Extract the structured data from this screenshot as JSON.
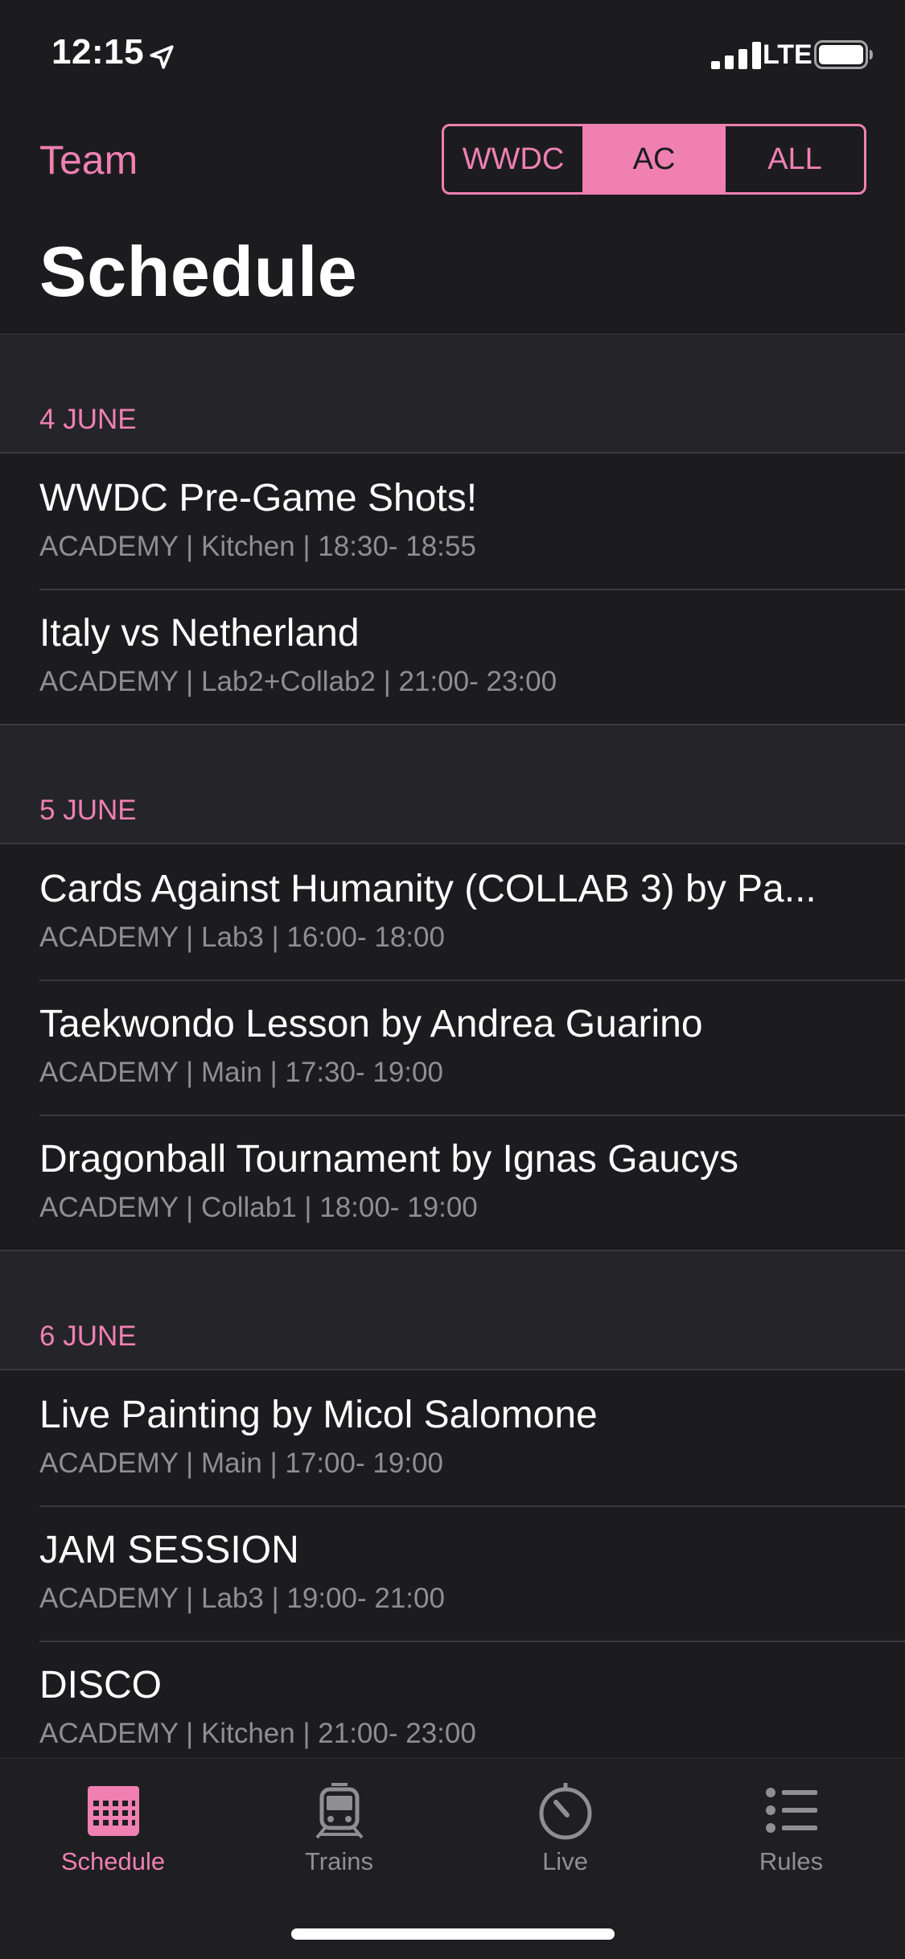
{
  "status_bar": {
    "time": "12:15",
    "network": "LTE"
  },
  "header": {
    "back_label": "Team",
    "title": "Schedule",
    "segments": [
      "WWDC",
      "AC",
      "ALL"
    ],
    "selected_segment": "AC"
  },
  "sections": [
    {
      "title": "4 JUNE",
      "items": [
        {
          "title": "WWDC Pre-Game Shots!",
          "subtitle": "ACADEMY | Kitchen | 18:30- 18:55"
        },
        {
          "title": "Italy vs Netherland",
          "subtitle": "ACADEMY | Lab2+Collab2 | 21:00- 23:00"
        }
      ]
    },
    {
      "title": "5 JUNE",
      "items": [
        {
          "title": "Cards Against Humanity (COLLAB 3) by Pa...",
          "subtitle": "ACADEMY | Lab3 | 16:00- 18:00"
        },
        {
          "title": "Taekwondo Lesson by Andrea Guarino",
          "subtitle": "ACADEMY | Main | 17:30- 19:00"
        },
        {
          "title": "Dragonball Tournament by Ignas Gaucys",
          "subtitle": "ACADEMY | Collab1 | 18:00- 19:00"
        }
      ]
    },
    {
      "title": "6 JUNE",
      "items": [
        {
          "title": "Live Painting by Micol Salomone",
          "subtitle": "ACADEMY | Main | 17:00- 19:00"
        },
        {
          "title": "JAM SESSION",
          "subtitle": "ACADEMY | Lab3 | 19:00- 21:00"
        },
        {
          "title": "DISCO",
          "subtitle": "ACADEMY | Kitchen | 21:00- 23:00"
        }
      ]
    }
  ],
  "tab_bar": {
    "tabs": [
      {
        "label": "Schedule",
        "icon": "calendar-icon",
        "active": true
      },
      {
        "label": "Trains",
        "icon": "train-icon",
        "active": false
      },
      {
        "label": "Live",
        "icon": "timer-icon",
        "active": false
      },
      {
        "label": "Rules",
        "icon": "list-icon",
        "active": false
      }
    ]
  },
  "colors": {
    "accent": "#f080b2",
    "background": "#1c1c1e",
    "secondary_text": "#8e8e93"
  }
}
